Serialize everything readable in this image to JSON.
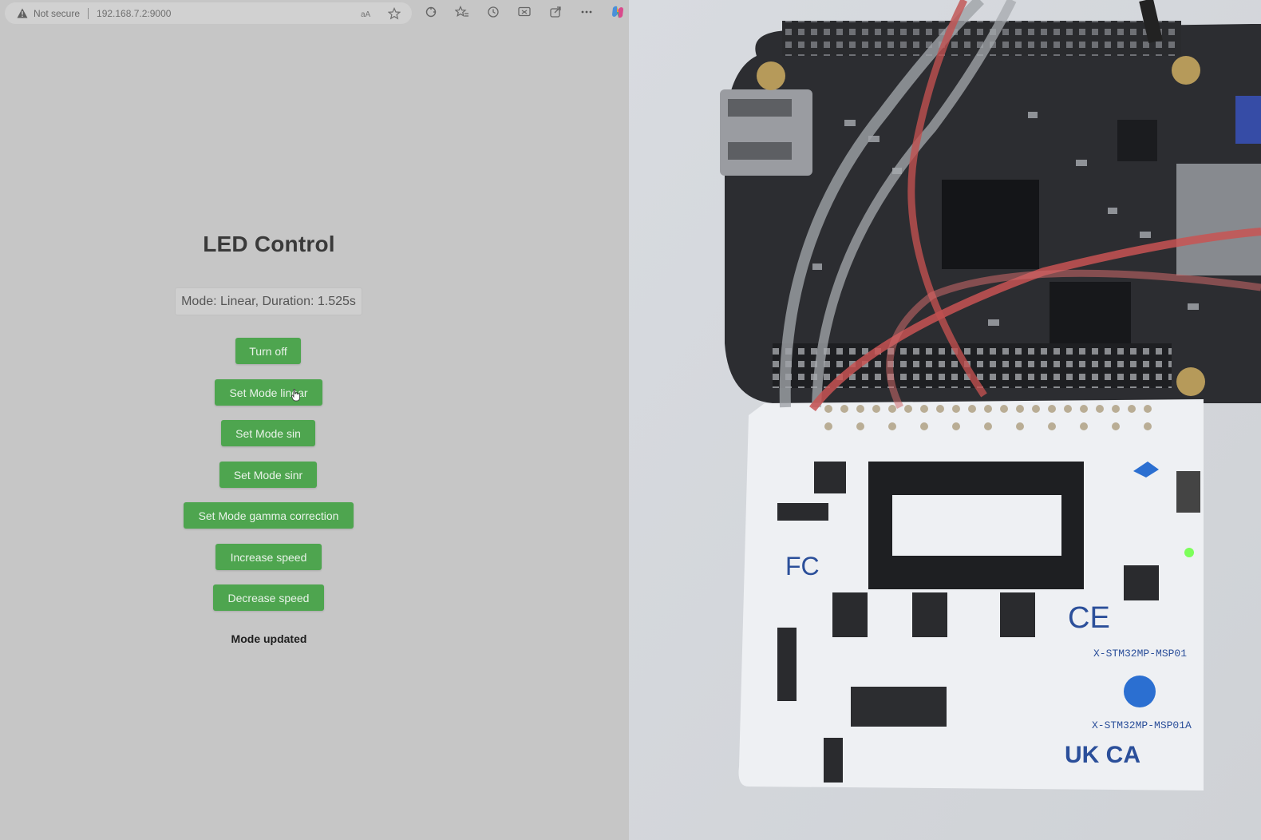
{
  "browser": {
    "security_label": "Not secure",
    "url": "192.168.7.2:9000"
  },
  "app": {
    "title": "LED Control",
    "status": "Mode: Linear, Duration: 1.525s",
    "buttons": {
      "turn_off": "Turn off",
      "linear": "Set Mode linear",
      "sin": "Set Mode sin",
      "sinr": "Set Mode sinr",
      "gamma": "Set Mode gamma correction",
      "increase": "Increase speed",
      "decrease": "Decrease speed"
    },
    "message": "Mode updated"
  },
  "photo": {
    "board_labels": {
      "label_1": "X-STM32MP-MSP01",
      "label_2": "X-STM32MP-MSP01A",
      "ukca": "UK CA",
      "ce": "CE",
      "fc": "FC"
    }
  },
  "colors": {
    "button_green": "#4ea54f",
    "page_bg": "#c6c6c6"
  },
  "icons": [
    "warning-icon",
    "read-aloud-icon",
    "favorite-star-icon",
    "extensions-icon",
    "favorites-icon",
    "history-icon",
    "screenshot-icon",
    "share-icon",
    "more-icon",
    "copilot-icon",
    "mouse-cursor-icon"
  ]
}
